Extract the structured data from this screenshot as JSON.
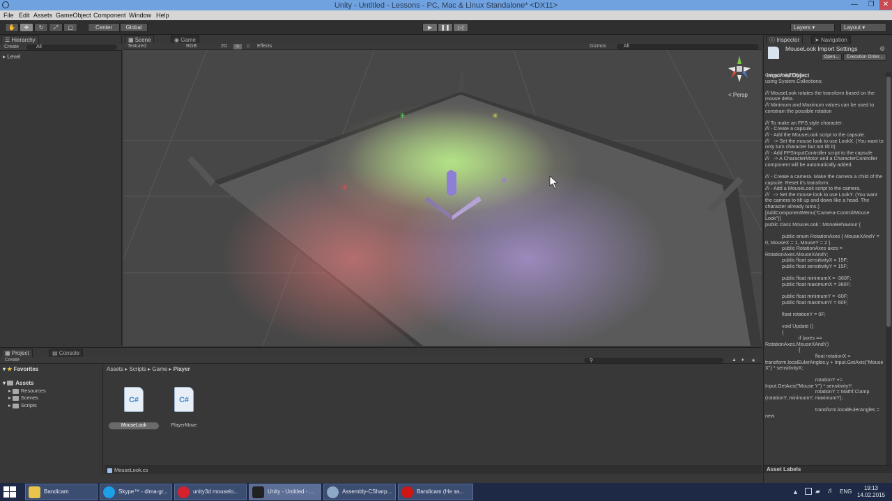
{
  "window": {
    "title": "Unity - Untitled - Lessons - PC, Mac & Linux Standalone* <DX11>"
  },
  "menu": [
    "File",
    "Edit",
    "Assets",
    "GameObject",
    "Component",
    "Window",
    "Help"
  ],
  "toolbar": {
    "center_label": "Center",
    "global_label": "Global",
    "layers_label": "Layers",
    "layout_label": "Layout"
  },
  "hierarchy": {
    "tab": "Hierarchy",
    "create": "Create",
    "search_placeholder": "All",
    "items": [
      "Level"
    ]
  },
  "scene": {
    "tab": "Scene",
    "game_tab": "Game",
    "shading": "Textured",
    "rgb": "RGB",
    "mode_2d": "2D",
    "effects": "Effects",
    "gizmos": "Gizmos",
    "search_placeholder": "All",
    "persp": "Persp"
  },
  "inspector": {
    "tab": "Inspector",
    "nav_tab": "Navigation",
    "asset_title": "MouseLook Import Settings",
    "open_button": "Open...",
    "exec_button": "Execution Order...",
    "section_title": "Imported Object",
    "code": "using UnityEngine;\nusing System.Collections;\n\n/// MouseLook rotates the transform based on the mouse delta.\n/// Minimum and Maximum values can be used to constrain the possible rotation\n\n/// To make an FPS style character:\n/// - Create a capsule.\n/// - Add the MouseLook script to the capsule.\n///   -> Set the mouse look to use LookX. (You want to only turn character but not tilt it)\n/// - Add FPSInputController script to the capsule\n///   -> A CharacterMotor and a CharacterController component will be automatically added.\n\n/// - Create a camera. Make the camera a child of the capsule. Reset it's transform.\n/// - Add a MouseLook script to the camera.\n///   -> Set the mouse look to use LookY. (You want the camera to tilt up and down like a head. The character already turns.)\n[AddComponentMenu(\"Camera-Control/Mouse Look\")]\npublic class MouseLook : MonoBehaviour {\n\n            public enum RotationAxes { MouseXAndY = 0, MouseX = 1, MouseY = 2 }\n            public RotationAxes axes = RotationAxes.MouseXAndY;\n            public float sensitivityX = 15F;\n            public float sensitivityY = 15F;\n\n            public float minimumX = -360F;\n            public float maximumX = 360F;\n\n            public float minimumY = -60F;\n            public float maximumY = 60F;\n\n            float rotationY = 0F;\n\n            void Update ()\n            {\n                        if (axes == RotationAxes.MouseXAndY)\n                        {\n                                    float rotationX = transform.localEulerAngles.y + Input.GetAxis(\"Mouse X\") * sensitivityX;\n\n                                    rotationY += Input.GetAxis(\"Mouse Y\") * sensitivityY;\n                                    rotationY = Mathf.Clamp (rotationY, minimumY, maximumY);\n\n                                    transform.localEulerAngles = new",
    "asset_labels": "Asset Labels"
  },
  "project": {
    "tab": "Project",
    "console_tab": "Console",
    "create": "Create",
    "favorites": "Favorites",
    "assets": "Assets",
    "folders": [
      "Resources",
      "Scenes",
      "Scripts"
    ],
    "breadcrumb": [
      "Assets",
      "Scripts",
      "Game",
      "Player"
    ],
    "files": [
      {
        "name": "MouseLook",
        "icon": "C#"
      },
      {
        "name": "PlayerMove",
        "icon": "C#"
      }
    ],
    "selected_file": "MouseLook.cs"
  },
  "taskbar": {
    "items": [
      "Bandicam",
      "Skype™ - dima-gr...",
      "unity3d mouselo...",
      "Unity - Untitled - ...",
      "Assembly-CSharp...",
      "Bandicam (Не за..."
    ],
    "lang": "ENG",
    "time": "19:13",
    "date": "14.02.2015"
  },
  "colors": {
    "accent": "#6fa2df",
    "unity_bg": "#383838",
    "taskbar": "#1e2a45"
  }
}
